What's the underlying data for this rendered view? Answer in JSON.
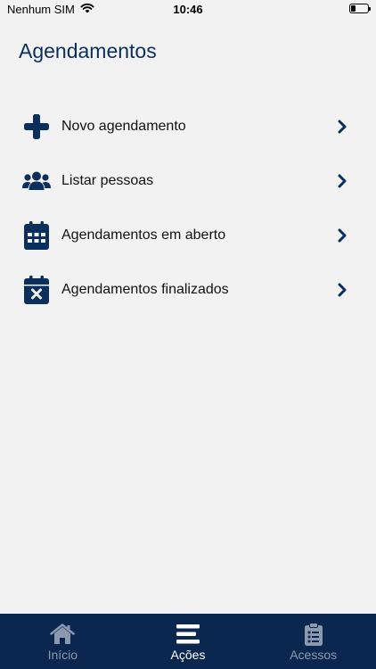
{
  "status_bar": {
    "carrier": "Nenhum SIM",
    "time": "10:46",
    "battery_level": 0.3
  },
  "page": {
    "title": "Agendamentos"
  },
  "menu": {
    "items": [
      {
        "label": "Novo agendamento",
        "icon": "plus-icon"
      },
      {
        "label": "Listar pessoas",
        "icon": "users-icon"
      },
      {
        "label": "Agendamentos em aberto",
        "icon": "calendar-icon"
      },
      {
        "label": "Agendamentos finalizados",
        "icon": "calendar-times-icon"
      }
    ]
  },
  "tab_bar": {
    "tabs": [
      {
        "label": "Início",
        "icon": "home-icon",
        "active": false
      },
      {
        "label": "Ações",
        "icon": "menu-bars-icon",
        "active": true
      },
      {
        "label": "Acessos",
        "icon": "clipboard-list-icon",
        "active": false
      }
    ]
  },
  "colors": {
    "primary": "#0a2f5c",
    "tab_bar_bg": "#0a2750",
    "tab_inactive": "#8a99ad",
    "tab_active": "#ffffff",
    "background": "#f2f2f2"
  }
}
